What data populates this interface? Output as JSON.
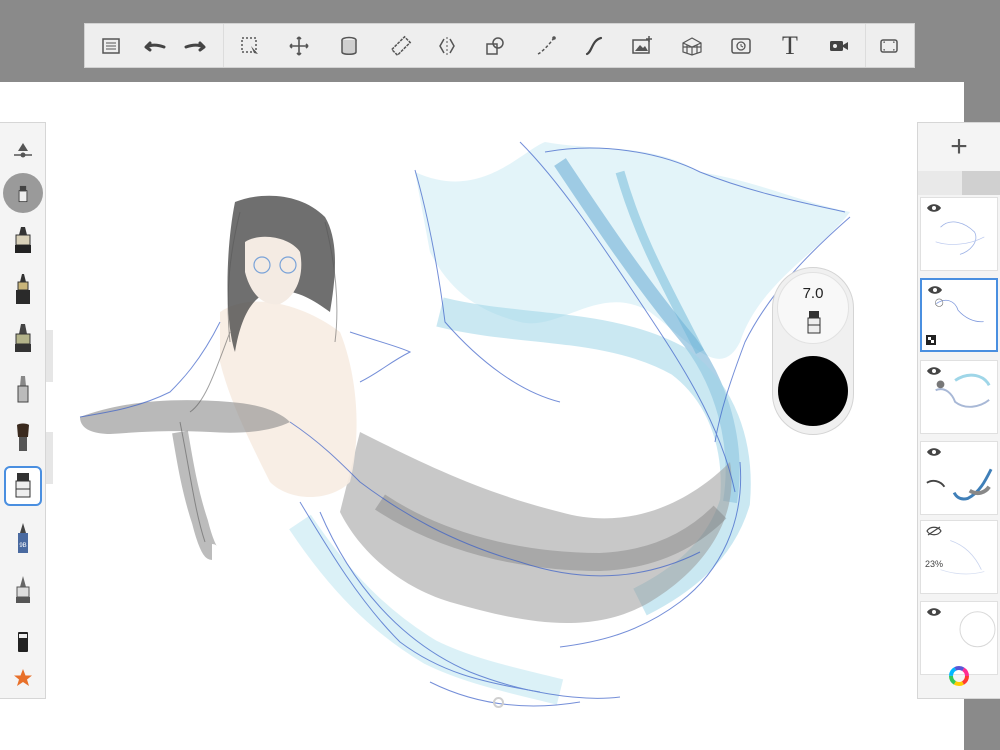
{
  "toolbar": {
    "tools": [
      {
        "name": "layer-list-icon"
      },
      {
        "name": "undo-icon"
      },
      {
        "name": "redo-icon"
      },
      {
        "name": "selection-icon"
      },
      {
        "name": "transform-icon"
      },
      {
        "name": "fill-icon"
      },
      {
        "name": "ruler-icon"
      },
      {
        "name": "symmetry-icon"
      },
      {
        "name": "shapes-icon"
      },
      {
        "name": "curve-icon"
      },
      {
        "name": "stroke-icon"
      },
      {
        "name": "add-image-icon"
      },
      {
        "name": "perspective-icon"
      },
      {
        "name": "time-lapse-icon"
      },
      {
        "name": "text-icon",
        "label": "T"
      },
      {
        "name": "record-icon"
      },
      {
        "name": "fullscreen-icon"
      }
    ]
  },
  "brush_palette": {
    "items": [
      {
        "name": "brush-size-slider-icon"
      },
      {
        "name": "brush-preset-current"
      },
      {
        "name": "pencil-brush-icon"
      },
      {
        "name": "inking-pen-icon"
      },
      {
        "name": "felt-marker-icon"
      },
      {
        "name": "airbrush-icon"
      },
      {
        "name": "paint-brush-icon"
      },
      {
        "name": "marker-brush-icon",
        "active": true
      },
      {
        "name": "pencil-9b-icon",
        "label": "9B"
      },
      {
        "name": "smudge-icon"
      },
      {
        "name": "eraser-icon"
      },
      {
        "name": "favorites-star-icon"
      }
    ]
  },
  "puck": {
    "size_value": "7.0",
    "color": "#000000"
  },
  "layers": {
    "add_label": "+",
    "items": [
      {
        "visible": true,
        "selected": false
      },
      {
        "visible": true,
        "selected": true
      },
      {
        "visible": true,
        "selected": false
      },
      {
        "visible": true,
        "selected": false
      },
      {
        "visible": false,
        "selected": false,
        "opacity": "23%"
      },
      {
        "visible": true,
        "selected": false
      }
    ]
  },
  "colors": {
    "accent": "#4a8fe0",
    "chrome_bg": "#8a8a8a",
    "panel_bg": "#f4f4f4"
  }
}
